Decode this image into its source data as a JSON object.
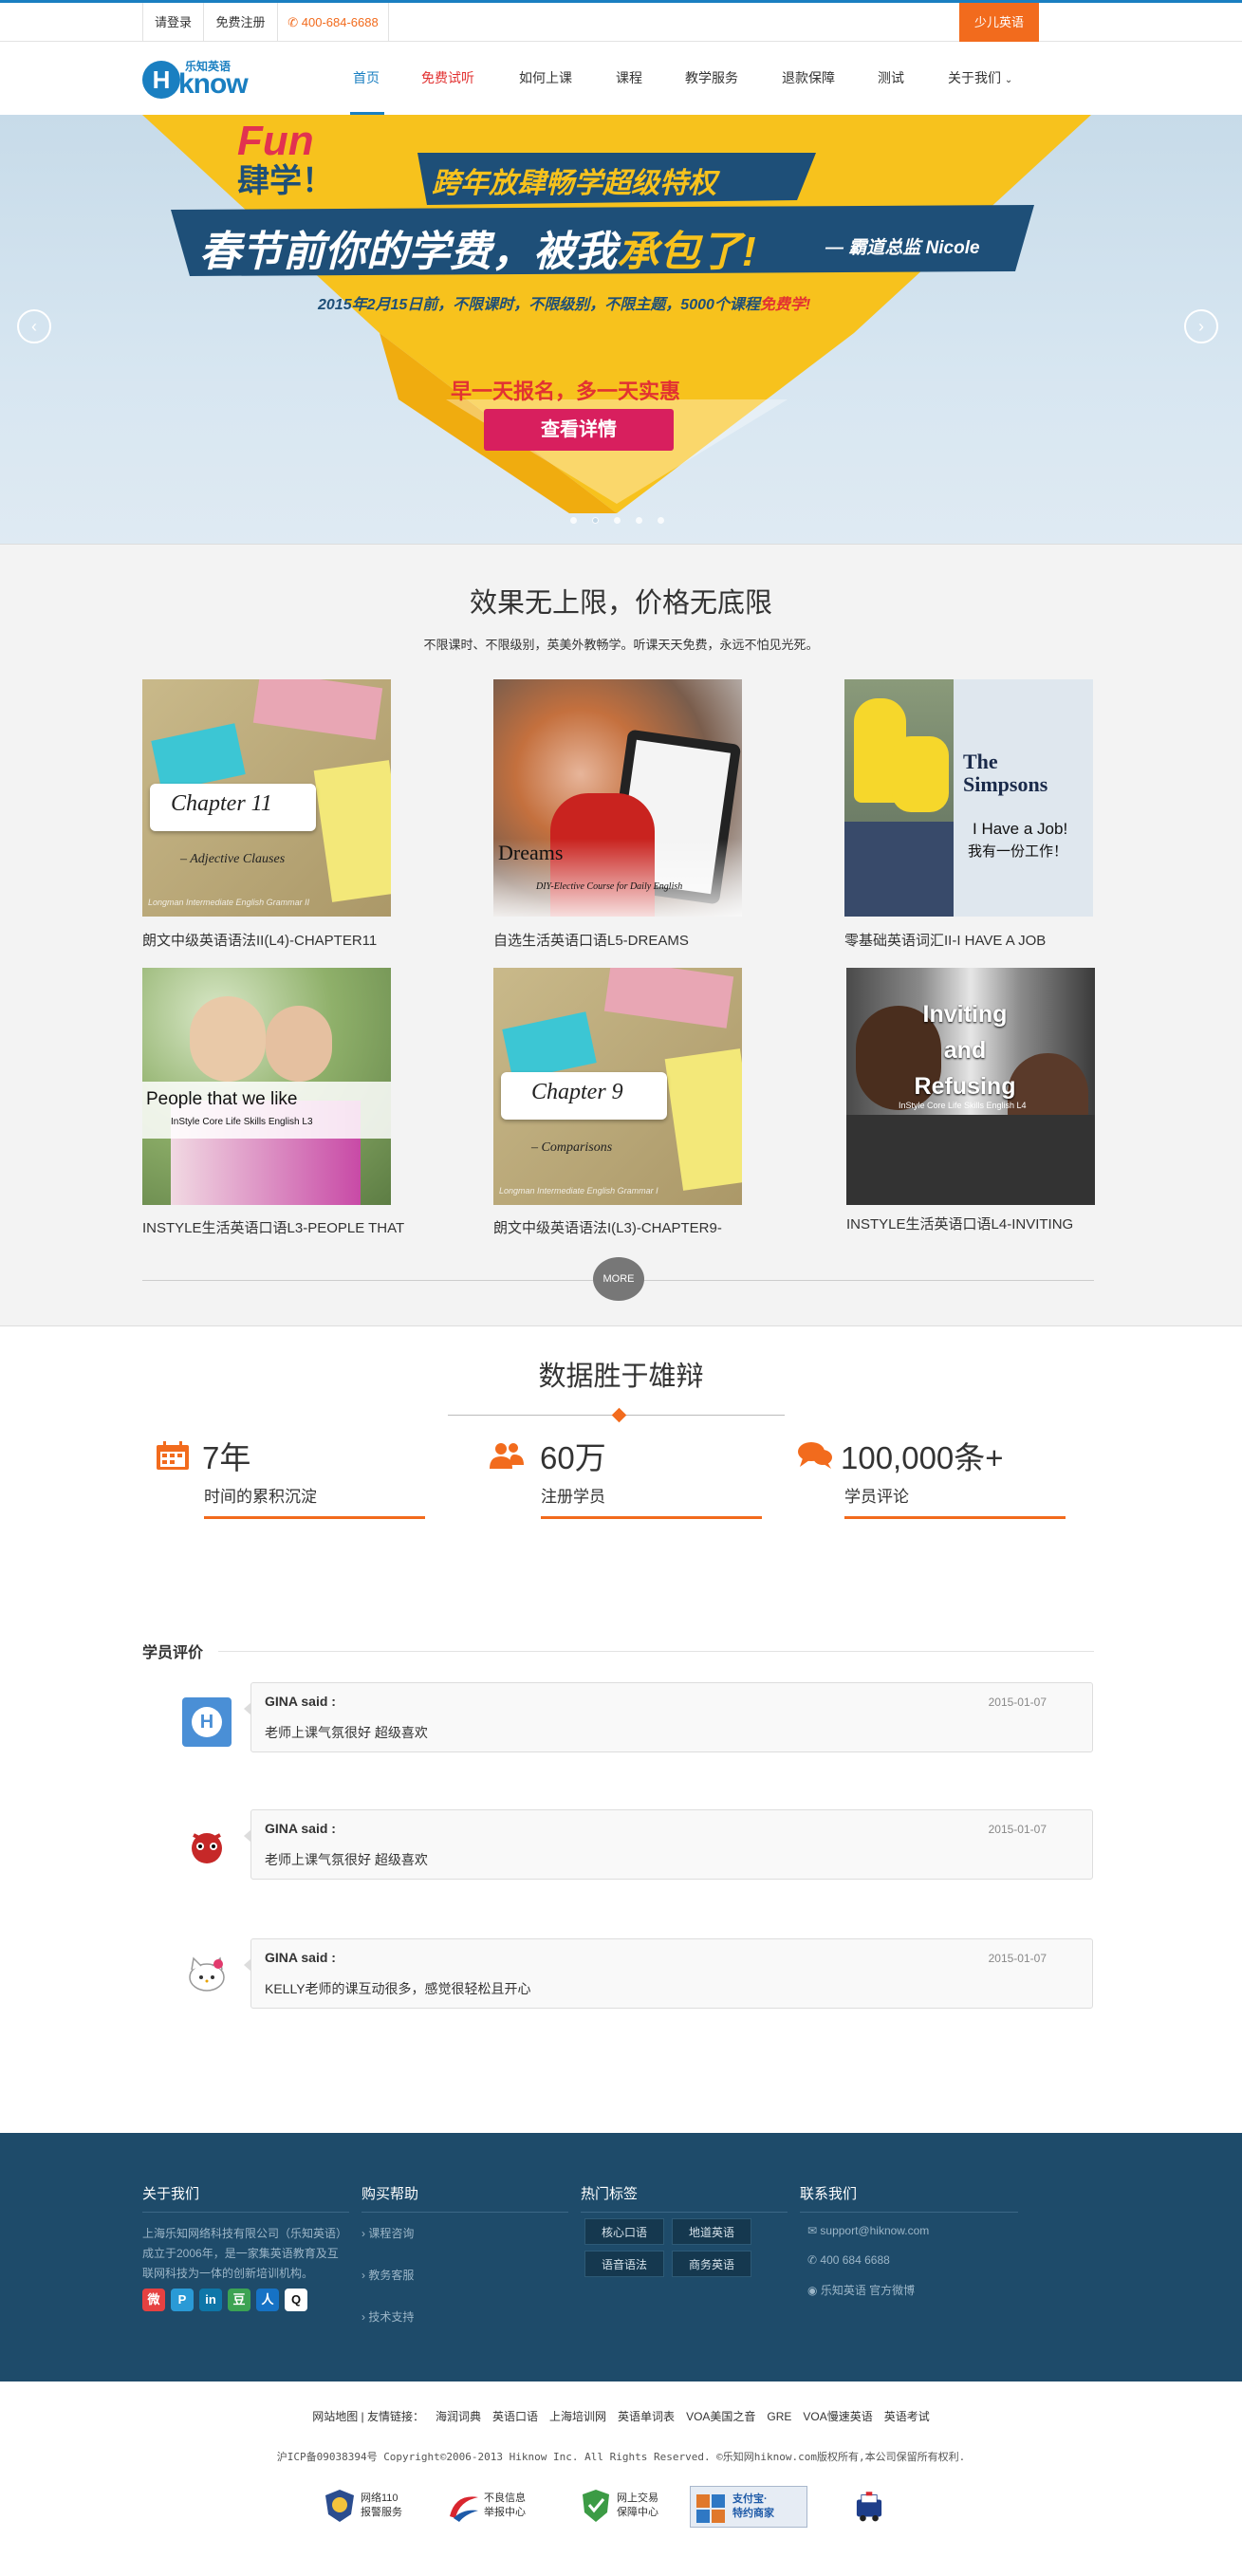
{
  "topbar": {
    "login": "请登录",
    "register": "免费注册",
    "phone": "400-684-6688",
    "kids": "少儿英语"
  },
  "logo": {
    "cn": "乐知英语",
    "en": "know",
    "h": "H"
  },
  "nav": [
    {
      "label": "首页"
    },
    {
      "label": "免费试听"
    },
    {
      "label": "如何上课"
    },
    {
      "label": "课程"
    },
    {
      "label": "教学服务"
    },
    {
      "label": "退款保障"
    },
    {
      "label": "测试"
    },
    {
      "label": "关于我们"
    }
  ],
  "banner": {
    "fun": "Fun",
    "fun2": "肆学！",
    "ribbon1": "跨年放肆畅学超级特权",
    "headline1": "春节前你的学费，被我",
    "headline2": "承包了!",
    "signature": "— 霸道总监  Nicole",
    "dateline_pre": "2015年2月15日前，不限课时，不限级别，不限主题，5000个课程",
    "dateline_free": "免费学!",
    "promo": "早一天报名，多一天实惠",
    "cta": "查看详情",
    "prev": "‹",
    "next": "›"
  },
  "courses_section": {
    "title": "效果无上限，价格无底限",
    "subtitle": "不限课时、不限级别，英美外教畅学。听课天天免费，永远不怕见光死。",
    "more": "MORE",
    "items": [
      {
        "caption": "朗文中级英语语法II(L4)-CHAPTER11",
        "img_title": "Chapter 11",
        "img_sub": "– Adjective Clauses",
        "img_foot": "Longman Intermediate English Grammar II"
      },
      {
        "caption": "自选生活英语口语L5-DREAMS",
        "img_title": "Dreams",
        "img_sub": "DIY-Elective Course for Daily English"
      },
      {
        "caption": "零基础英语词汇II-I HAVE A JOB",
        "img_title": "The Simpsons",
        "img_sub": "I Have a Job!",
        "img_sub2": "我有一份工作！"
      },
      {
        "caption": "INSTYLE生活英语口语L3-PEOPLE THAT",
        "img_title": "People that we like",
        "img_sub": "InStyle Core Life Skills English L3"
      },
      {
        "caption": "朗文中级英语语法I(L3)-CHAPTER9-",
        "img_title": "Chapter 9",
        "img_sub": "– Comparisons",
        "img_foot": "Longman Intermediate English Grammar I"
      },
      {
        "caption": "INSTYLE生活英语口语L4-INVITING",
        "img_title": "Inviting and Refusing",
        "img_sub": "InStyle Core Life Skills English L4"
      }
    ]
  },
  "stats_section": {
    "title": "数据胜于雄辩",
    "items": [
      {
        "num": "7年",
        "label": "时间的累积沉淀",
        "icon": "calendar-icon"
      },
      {
        "num": "60万",
        "label": "注册学员",
        "icon": "users-icon"
      },
      {
        "num": "100,000条+",
        "label": "学员评论",
        "icon": "comments-icon"
      }
    ]
  },
  "reviews_section": {
    "title": "学员评价",
    "items": [
      {
        "name": "GINA said :",
        "date": "2015-01-07",
        "text": "老师上课气氛很好  超级喜欢"
      },
      {
        "name": "GINA said :",
        "date": "2015-01-07",
        "text": "老师上课气氛很好  超级喜欢"
      },
      {
        "name": "GINA said :",
        "date": "2015-01-07",
        "text": "KELLY老师的课互动很多，感觉很轻松且开心"
      }
    ]
  },
  "footer": {
    "about": {
      "title": "关于我们",
      "text": "上海乐知网络科技有限公司（乐知英语）成立于2006年，是一家集英语教育及互联网科技为一体的创新培训机构。"
    },
    "help": {
      "title": "购买帮助",
      "links": [
        "课程咨询",
        "教务客服",
        "技术支持"
      ]
    },
    "tags": {
      "title": "热门标签",
      "items": [
        "核心口语",
        "地道英语",
        "语音语法",
        "商务英语"
      ]
    },
    "contact": {
      "title": "联系我们",
      "email": "support@hiknow.com",
      "phone": "400 684 6688",
      "weibo": "乐知英语 官方微博"
    },
    "social": [
      "微",
      "P",
      "in",
      "豆",
      "人",
      "Q"
    ]
  },
  "bottom": {
    "links_prefix": "网站地图  |  友情链接：",
    "links": [
      "海润词典",
      "英语口语",
      "上海培训网",
      "英语单词表",
      "VOA美国之音",
      "GRE",
      "VOA慢速英语",
      "英语考试"
    ],
    "copyright": "沪ICP备09038394号 Copyright©2006-2013 Hiknow Inc. All Rights Reserved. ©乐知网hiknow.com版权所有,本公司保留所有权利.",
    "badges": [
      {
        "line1": "网络110",
        "line2": "报警服务"
      },
      {
        "line1": "不良信息",
        "line2": "举报中心"
      },
      {
        "line1": "网上交易",
        "line2": "保障中心"
      },
      {
        "line1": "支付宝·",
        "line2": "特约商家"
      }
    ]
  },
  "colors": {
    "brand_blue": "#1a7fc1",
    "orange": "#f26b1d",
    "footer_bg": "#1e4b6a",
    "banner_yellow": "#f7c21d",
    "banner_navy": "#1e4f78",
    "cta_pink": "#d81f5e"
  }
}
